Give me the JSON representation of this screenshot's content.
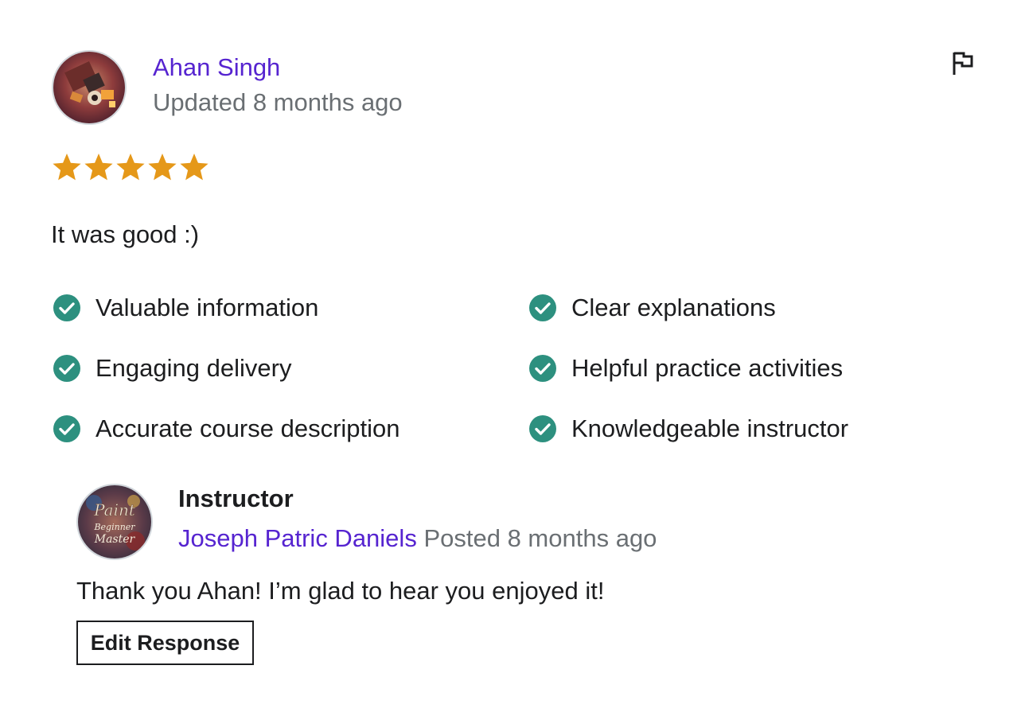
{
  "review": {
    "reviewer": {
      "name": "Ahan Singh",
      "updated_text": "Updated 8 months ago",
      "avatar_icon": "reviewer-avatar-image"
    },
    "rating": {
      "stars": 5,
      "max": 5,
      "color": "#e59819"
    },
    "comment": "It was good :)",
    "report_icon": "flag-icon",
    "feedback_tags": [
      {
        "label": "Valuable information"
      },
      {
        "label": "Clear explanations"
      },
      {
        "label": "Engaging delivery"
      },
      {
        "label": "Helpful practice activities"
      },
      {
        "label": "Accurate course description"
      },
      {
        "label": "Knowledgeable instructor"
      }
    ],
    "check_color": "#2d907f"
  },
  "response": {
    "role": "Instructor",
    "instructor_name": "Joseph Patric Daniels",
    "posted_text": "Posted 8 months ago",
    "text": "Thank you Ahan! I’m glad to hear you enjoyed it!",
    "edit_button_label": "Edit Response",
    "avatar_logo_text": "Paint Beginner Master"
  },
  "colors": {
    "link": "#5624d0",
    "muted": "#6a6f73",
    "text": "#1c1d1f"
  }
}
